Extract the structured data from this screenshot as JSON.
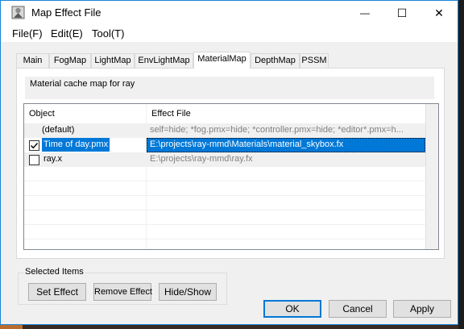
{
  "window": {
    "title": "Map Effect File",
    "minimize_glyph": "—",
    "maximize_glyph": "☐",
    "close_glyph": "✕"
  },
  "menu": [
    "File(F)",
    "Edit(E)",
    "Tool(T)"
  ],
  "tabs": [
    {
      "label": "Main",
      "active": false
    },
    {
      "label": "FogMap",
      "active": false
    },
    {
      "label": "LightMap",
      "active": false
    },
    {
      "label": "EnvLightMap",
      "active": false
    },
    {
      "label": "MaterialMap",
      "active": true
    },
    {
      "label": "DepthMap",
      "active": false
    },
    {
      "label": "PSSM",
      "active": false
    }
  ],
  "description": "Material cache map for ray",
  "list": {
    "columns": [
      "Object",
      "Effect File"
    ],
    "rows": [
      {
        "object": "(default)",
        "effect_file": "self=hide; *fog.pmx=hide; *controller.pmx=hide; *editor*.pmx=h...",
        "checkbox": false,
        "checked": false,
        "selected": false
      },
      {
        "object": "Time of day.pmx",
        "effect_file": "E:\\projects\\ray-mmd\\Materials\\material_skybox.fx",
        "checkbox": true,
        "checked": true,
        "selected": true
      },
      {
        "object": "ray.x",
        "effect_file": "E:\\projects\\ray-mmd\\ray.fx",
        "checkbox": true,
        "checked": false,
        "selected": false
      }
    ]
  },
  "selected_items": {
    "label": "Selected Items",
    "set_effect": "Set Effect",
    "remove_effect": "Remove Effect",
    "hide_show": "Hide/Show"
  },
  "dialog": {
    "ok": "OK",
    "cancel": "Cancel",
    "apply": "Apply"
  },
  "colors": {
    "selection": "#0078d7",
    "window_border": "#1883d7",
    "panel_bg": "#f0f0f0"
  }
}
